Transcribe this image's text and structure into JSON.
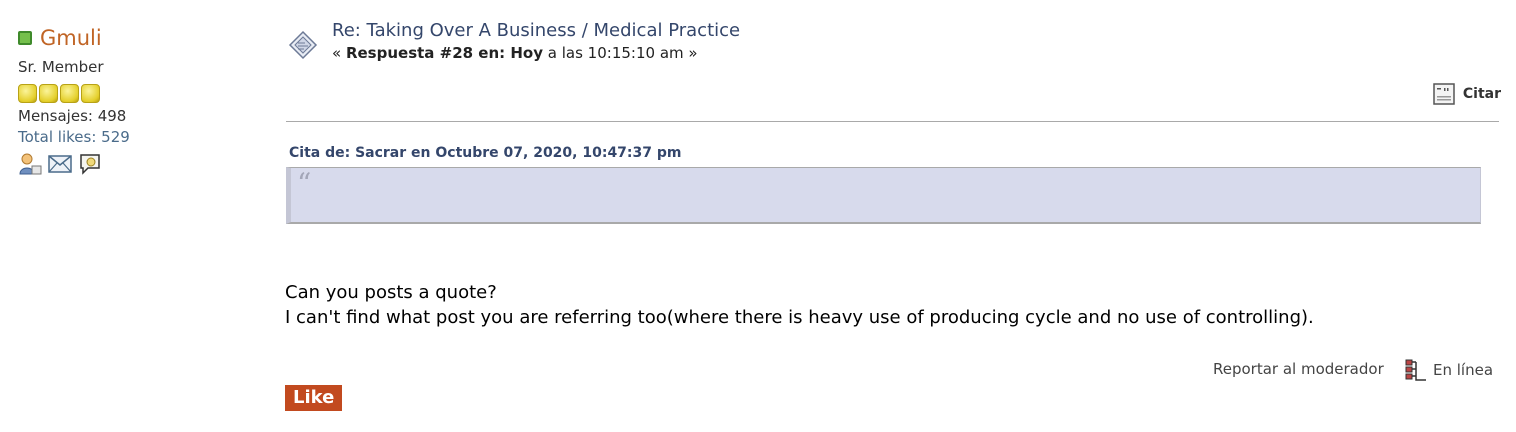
{
  "poster": {
    "name": "Gmuli",
    "rank": "Sr. Member",
    "stars": 4,
    "posts": "Mensajes: 498",
    "likes": "Total likes: 529",
    "status_color": "#75c04c"
  },
  "post": {
    "subject": "Re: Taking Over A Business / Medical Practice",
    "meta_prefix": "« ",
    "meta_bold": "Respuesta #28 en: Hoy",
    "meta_suffix": " a las 10:15:10 am »"
  },
  "actions": {
    "quote_label": "Citar",
    "report_label": "Reportar al moderador",
    "online_label": "En línea",
    "like_label": "Like"
  },
  "quote": {
    "header": "Cita de: Sacrar en Octubre 07, 2020, 10:47:37 pm",
    "mark": "“"
  },
  "body": {
    "line1": "Can you posts a quote?",
    "line2": "I can't find what post you are referring too(where there is heavy use of producing cycle and no use of controlling)."
  },
  "icons": {
    "online": "online-status-icon",
    "profile": "profile-icon",
    "email": "email-icon",
    "pm": "personal-message-icon",
    "post": "post-icon",
    "quote": "quote-icon",
    "ip": "ip-logged-icon"
  },
  "colors": {
    "name": "#c06425",
    "subject": "#34466b",
    "quote_bg": "#d7daec",
    "like_bg": "#c24a1f"
  }
}
